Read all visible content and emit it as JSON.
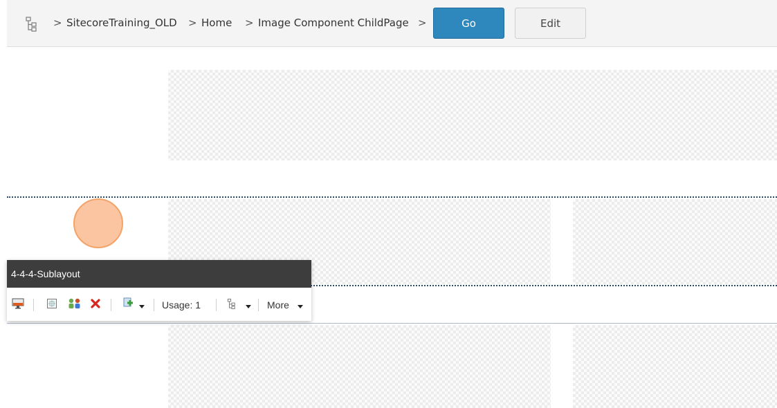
{
  "breadcrumb": {
    "items": [
      "SitecoreTraining_OLD",
      "Home",
      "Image Component ChildPage"
    ],
    "separator": ">"
  },
  "actions": {
    "go_label": "Go",
    "edit_label": "Edit"
  },
  "sublayout": {
    "title": "4-4-4-Sublayout",
    "usage_label": "Usage: 1",
    "more_label": "More"
  },
  "colors": {
    "accent": "#2f88bd",
    "panel_header": "#3d3d3d",
    "cursor": "#f4a368"
  },
  "icons": [
    "tree-icon",
    "preview-icon",
    "edit-related-icon",
    "personalize-icon",
    "remove-icon",
    "add-component-icon",
    "dropdown-caret-icon"
  ]
}
